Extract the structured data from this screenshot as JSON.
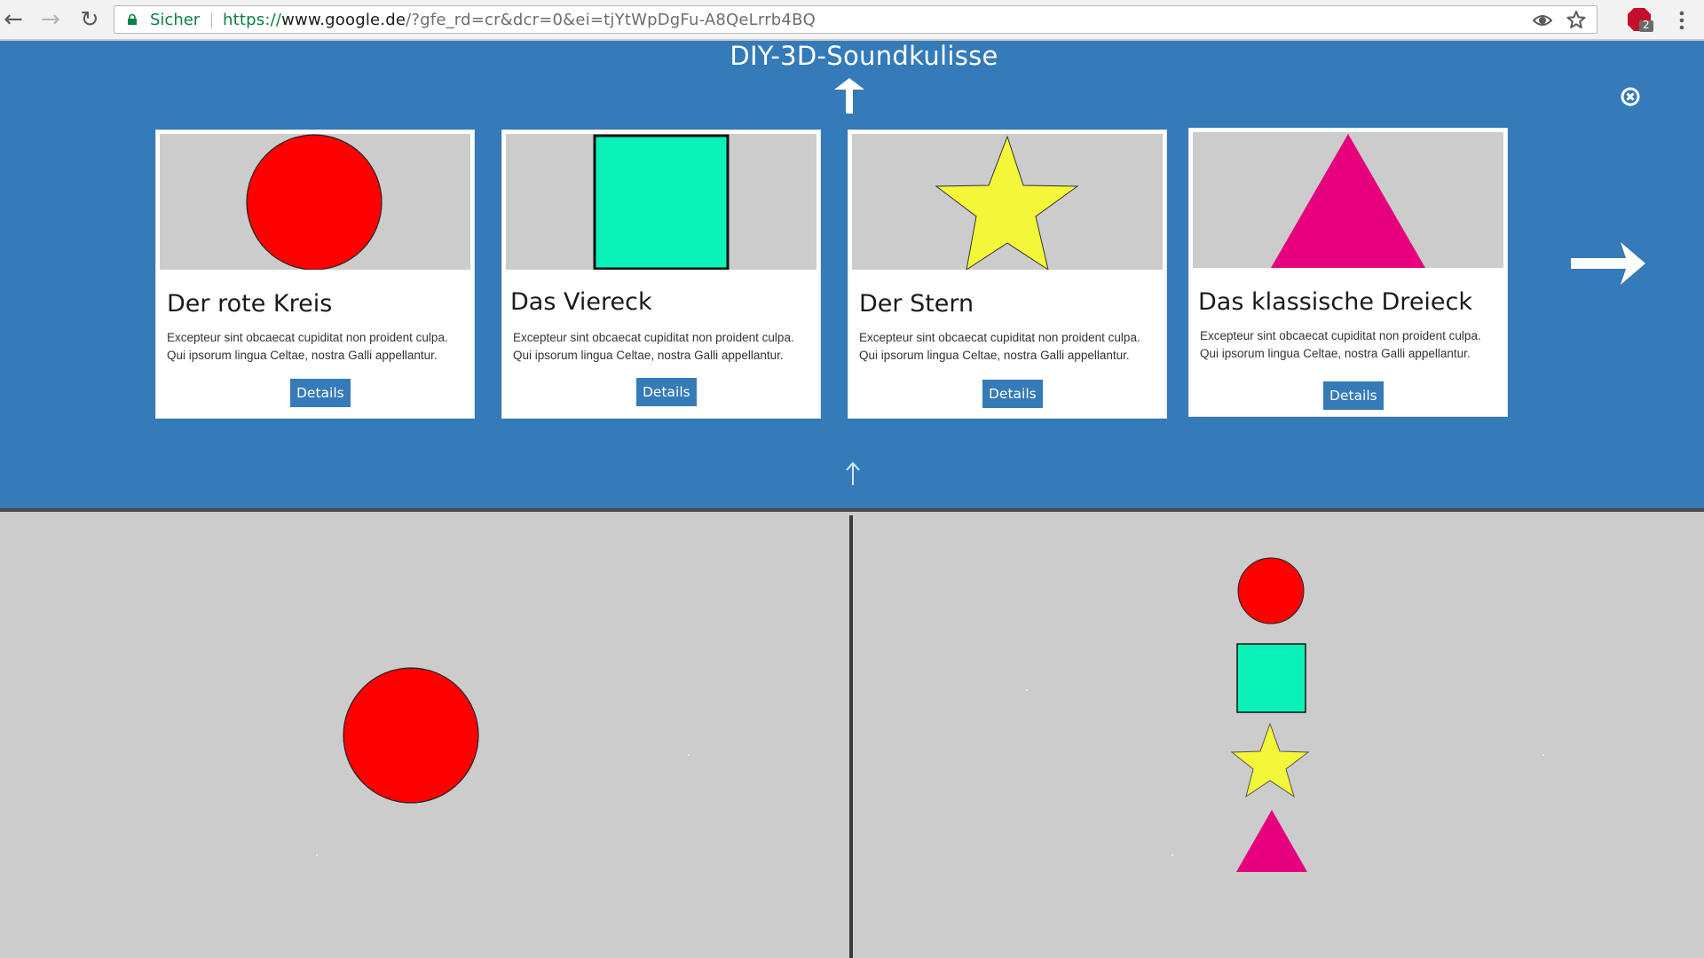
{
  "browser": {
    "secure_label": "Sicher",
    "url_scheme": "https://",
    "url_host": "www.google.de",
    "url_path": "/?gfe_rd=cr&dcr=0&ei=tjYtWpDgFu-A8QeLrrb4BQ",
    "extension_badge": "2",
    "icons": [
      "back-icon",
      "forward-icon",
      "reload-icon",
      "lock-icon",
      "eye-icon",
      "star-icon",
      "adblock-icon",
      "menu-icon"
    ]
  },
  "panel": {
    "title": "DIY-3D-Soundkulisse",
    "background_color": "#357ab9",
    "icons": [
      "up-arrow-icon",
      "close-icon",
      "next-arrow-icon"
    ]
  },
  "cards": [
    {
      "title": "Der rote Kreis",
      "line1": "Excepteur sint obcaecat cupiditat non proident culpa.",
      "line2": "Qui ipsorum lingua Celtae, nostra Galli appellantur.",
      "button": "Details",
      "shape": "circle",
      "color": "#ff0000"
    },
    {
      "title": "Das Viereck",
      "line1": "Excepteur sint obcaecat cupiditat non proident culpa.",
      "line2": "Qui ipsorum lingua Celtae, nostra Galli appellantur.",
      "button": "Details",
      "shape": "square",
      "color": "#0af2b8"
    },
    {
      "title": "Der Stern",
      "line1": "Excepteur sint obcaecat cupiditat non proident culpa.",
      "line2": "Qui ipsorum lingua Celtae, nostra Galli appellantur.",
      "button": "Details",
      "shape": "star",
      "color": "#f4f737"
    },
    {
      "title": "Das klassische Dreieck",
      "line1": "Excepteur sint obcaecat cupiditat non proident culpa.",
      "line2": "Qui ipsorum lingua Celtae, nostra Galli appellantur.",
      "button": "Details",
      "shape": "triangle",
      "color": "#e6007e"
    }
  ],
  "viewports": {
    "left": {
      "shapes": [
        "circle"
      ]
    },
    "right": {
      "shapes": [
        "circle",
        "square",
        "star",
        "triangle"
      ]
    }
  }
}
